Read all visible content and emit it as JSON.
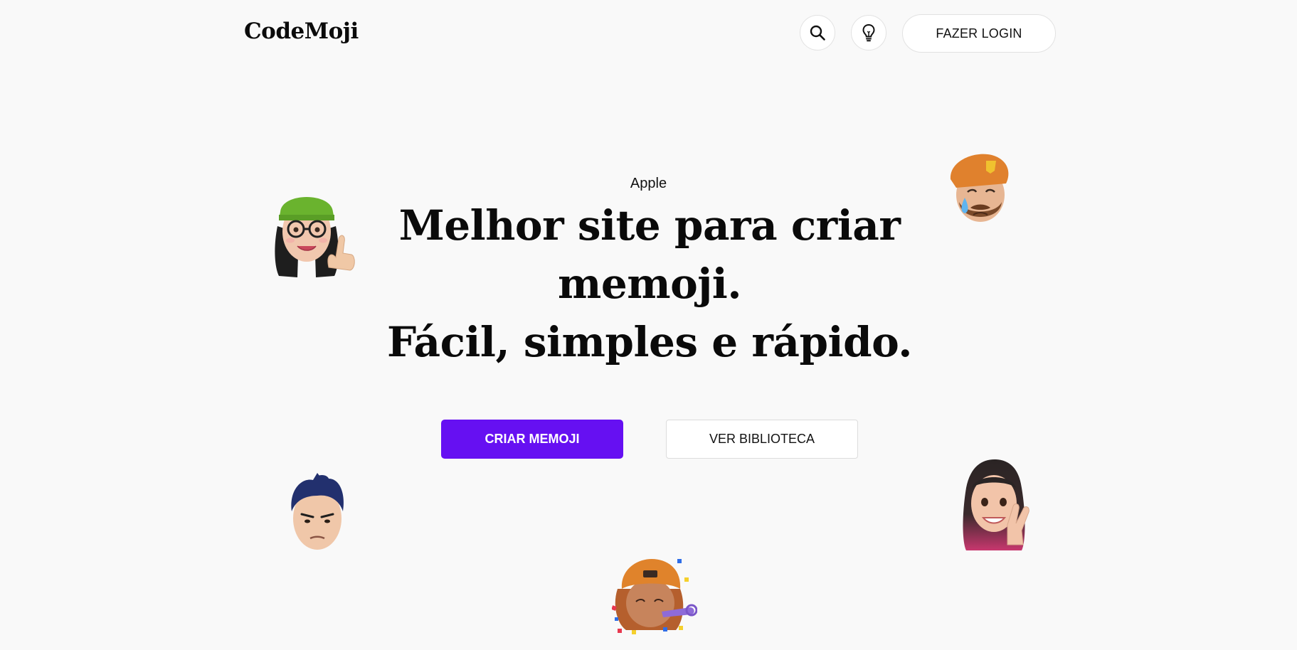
{
  "header": {
    "logo": "CodeMoji",
    "search_icon": "search-icon",
    "idea_icon": "lightbulb-icon",
    "login_label": "FAZER LOGIN"
  },
  "hero": {
    "eyebrow": "Apple",
    "title_lines": [
      "Melhor site para criar",
      "memoji.",
      "Fácil, simples e rápido."
    ],
    "primary_button": "CRIAR MEMOJI",
    "secondary_button": "VER BIBLIOTECA"
  },
  "memojis": [
    "memoji-green-beanie-thumbs-up",
    "memoji-orange-beret-crying",
    "memoji-blue-hair-angry",
    "memoji-pink-hair-peace-sign",
    "memoji-orange-cap-party"
  ],
  "colors": {
    "background": "#f9f9f9",
    "primary": "#6610f2",
    "text": "#0a0a0a",
    "border": "#e2e2e2"
  }
}
